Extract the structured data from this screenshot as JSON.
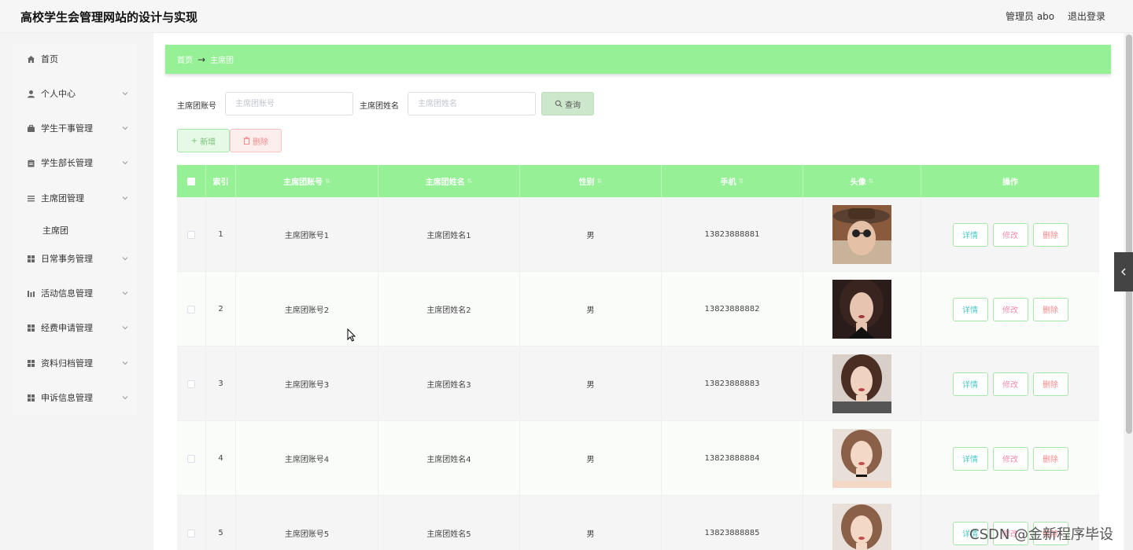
{
  "header": {
    "title": "高校学生会管理网站的设计与实现",
    "admin_label": "管理员 abo",
    "logout_label": "退出登录"
  },
  "sidebar": {
    "items": [
      {
        "label": "首页",
        "icon": "home-icon"
      },
      {
        "label": "个人中心",
        "icon": "user-icon"
      },
      {
        "label": "学生干事管理",
        "icon": "briefcase-icon"
      },
      {
        "label": "学生部长管理",
        "icon": "clipboard-icon"
      },
      {
        "label": "主席团管理",
        "icon": "list-icon"
      },
      {
        "label": "日常事务管理",
        "icon": "grid-icon"
      },
      {
        "label": "活动信息管理",
        "icon": "bar-chart-icon"
      },
      {
        "label": "经费申请管理",
        "icon": "grid-icon"
      },
      {
        "label": "资料归档管理",
        "icon": "grid-icon"
      },
      {
        "label": "申诉信息管理",
        "icon": "grid-icon"
      }
    ],
    "sub_item": "主席团"
  },
  "breadcrumb": {
    "home": "首页",
    "separator": "→",
    "current": "主席团"
  },
  "search": {
    "account_label": "主席团账号",
    "account_placeholder": "主席团账号",
    "name_label": "主席团姓名",
    "name_placeholder": "主席团姓名",
    "query_label": "查询"
  },
  "actions": {
    "add_label": "新增",
    "delete_label": "删除"
  },
  "table": {
    "headers": {
      "index": "索引",
      "account": "主席团账号",
      "name": "主席团姓名",
      "gender": "性别",
      "phone": "手机",
      "avatar": "头像",
      "operation": "操作"
    },
    "row_actions": {
      "detail": "详情",
      "edit": "修改",
      "delete": "删除"
    },
    "rows": [
      {
        "index": "1",
        "account": "主席团账号1",
        "name": "主席团姓名1",
        "gender": "男",
        "phone": "13823888881"
      },
      {
        "index": "2",
        "account": "主席团账号2",
        "name": "主席团姓名2",
        "gender": "男",
        "phone": "13823888882"
      },
      {
        "index": "3",
        "account": "主席团账号3",
        "name": "主席团姓名3",
        "gender": "男",
        "phone": "13823888883"
      },
      {
        "index": "4",
        "account": "主席团账号4",
        "name": "主席团姓名4",
        "gender": "男",
        "phone": "13823888884"
      },
      {
        "index": "5",
        "account": "主席团账号5",
        "name": "主席团姓名5",
        "gender": "男",
        "phone": "13823888885"
      }
    ]
  },
  "watermark": "CSDN @金新程序毕设",
  "colors": {
    "accent_green": "#96f096",
    "detail_text": "#4fc7c7",
    "edit_text": "#f28bb0",
    "delete_text": "#f28b8b"
  }
}
